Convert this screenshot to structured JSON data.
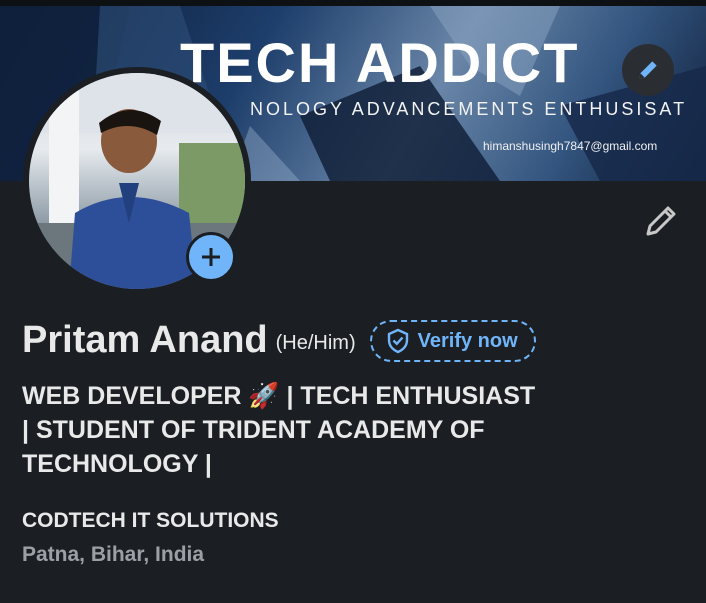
{
  "banner": {
    "title": "TECH ADDICT",
    "subtitle": "NOLOGY ADVANCEMENTS ENTHUSISAT",
    "email": "himanshusingh7847@gmail.com"
  },
  "profile": {
    "name": "Pritam Anand",
    "pronouns": "(He/Him)",
    "verify_label": "Verify now",
    "headline_line1": "WEB DEVELOPER 🚀 | TECH ENTHUSIAST",
    "headline_line2": "|  STUDENT OF TRIDENT ACADEMY OF",
    "headline_line3": "TECHNOLOGY |",
    "company": "CODTECH IT SOLUTIONS",
    "location": "Patna, Bihar, India"
  },
  "icons": {
    "banner_edit": "pencil-icon",
    "profile_edit": "pencil-icon",
    "add_photo": "plus-icon",
    "verify": "shield-check-icon"
  },
  "colors": {
    "accent": "#70b5f9",
    "background": "#1b1f23",
    "text": "#e9e9e9",
    "muted": "#9aa0a6"
  }
}
